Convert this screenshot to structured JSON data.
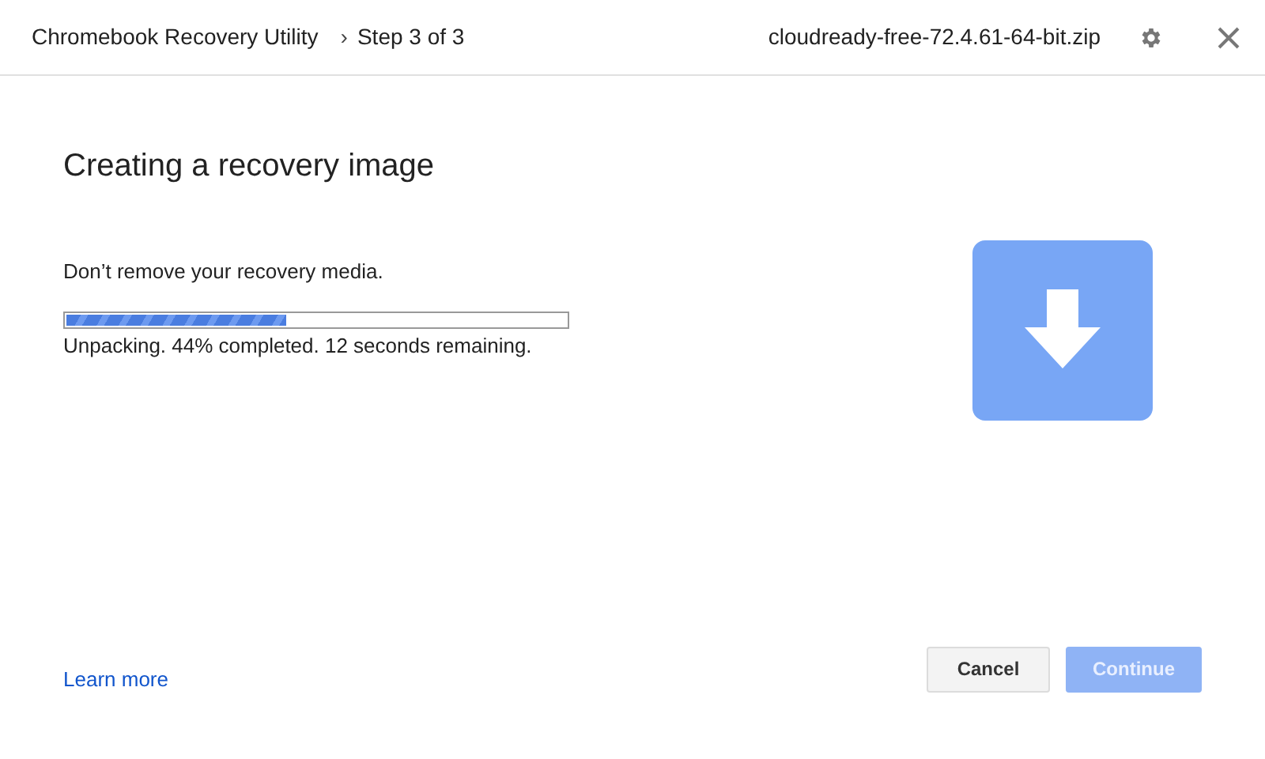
{
  "header": {
    "app_name": "Chromebook Recovery Utility",
    "separator": "›",
    "step": "Step 3 of 3",
    "file_name": "cloudready-free-72.4.61-64-bit.zip"
  },
  "title": "Creating a recovery image",
  "message": "Don’t remove your recovery media.",
  "progress": {
    "level": 0.44,
    "status": "Unpacking. 44% completed. 12 seconds remaining."
  },
  "footer": {
    "link": "Learn more",
    "buttons": [
      {
        "label": "Cancel",
        "kind": "secondary",
        "disabled": false
      },
      {
        "label": "Continue",
        "kind": "primary",
        "disabled": true
      }
    ]
  }
}
